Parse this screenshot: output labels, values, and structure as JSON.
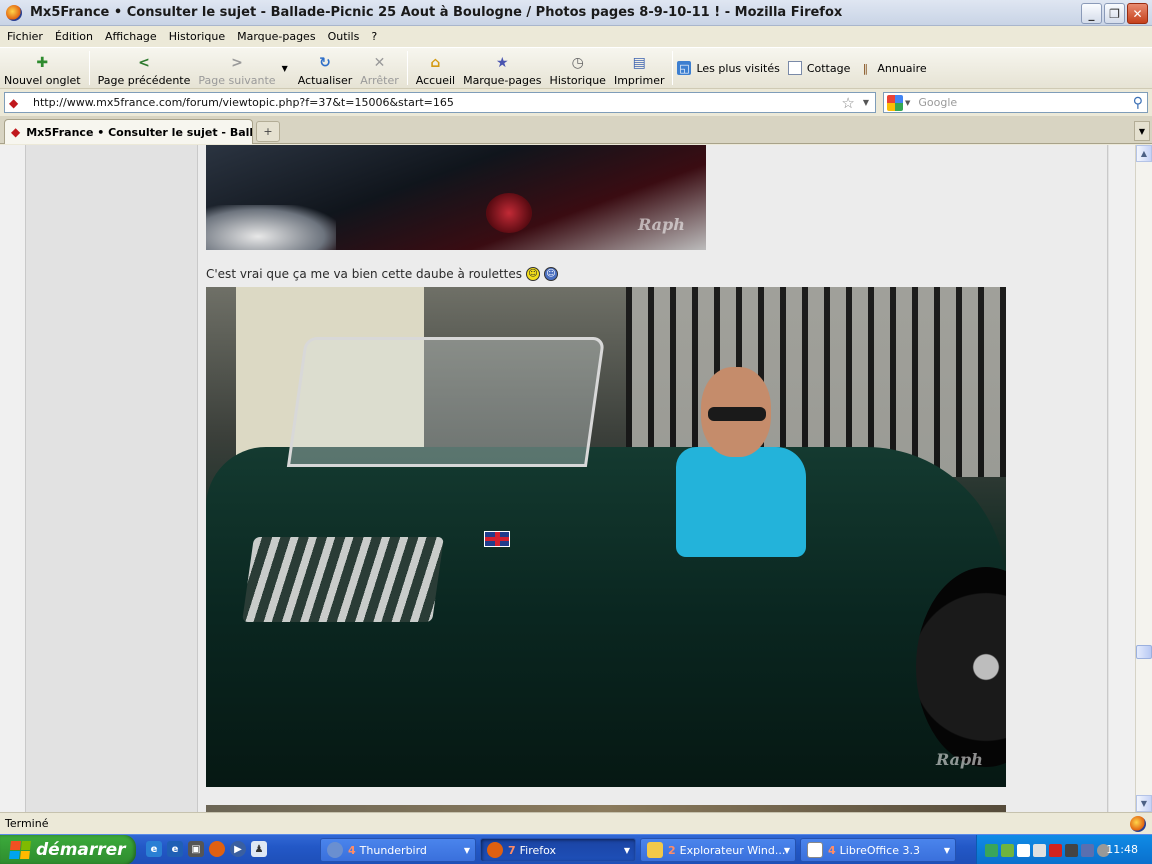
{
  "window": {
    "title": "Mx5France • Consulter le sujet - Ballade-Picnic 25 Aout à Boulogne / Photos pages 8-9-10-11 ! - Mozilla Firefox",
    "min": "_",
    "max": "❐",
    "close": "✕"
  },
  "menu": {
    "items": [
      "Fichier",
      "Édition",
      "Affichage",
      "Historique",
      "Marque-pages",
      "Outils",
      "?"
    ]
  },
  "toolbar": {
    "new_tab": "Nouvel onglet",
    "back": "Page précédente",
    "forward": "Page suivante",
    "reload": "Actualiser",
    "stop": "Arrêter",
    "home": "Accueil",
    "bookmarks": "Marque-pages",
    "history": "Historique",
    "print": "Imprimer"
  },
  "bookmarks_bar": {
    "items": [
      "Les plus visités",
      "Cottage",
      "Annuaire"
    ]
  },
  "urlbar": {
    "url": "http://www.mx5france.com/forum/viewtopic.php?f=37&t=15006&start=165"
  },
  "search": {
    "placeholder": "Google"
  },
  "tabs": {
    "active_label": "Mx5France • Consulter le sujet - Ball...",
    "new_tab_symbol": "+"
  },
  "post": {
    "text": "C'est vrai que ça me va bien cette daube à roulettes",
    "watermark": "Raph"
  },
  "statusbar": {
    "text": "Terminé"
  },
  "taskbar": {
    "start_label": "démarrer",
    "tasks": [
      {
        "count": "4",
        "label": "Thunderbird"
      },
      {
        "count": "7",
        "label": "Firefox"
      },
      {
        "count": "2",
        "label": "Explorateur Wind..."
      },
      {
        "count": "4",
        "label": "LibreOffice 3.3"
      }
    ],
    "clock": "11:48"
  },
  "colors": {
    "taskbar_blue": "#2358c7",
    "start_green": "#3cab3c",
    "tray_blue": "#0f8be6"
  }
}
